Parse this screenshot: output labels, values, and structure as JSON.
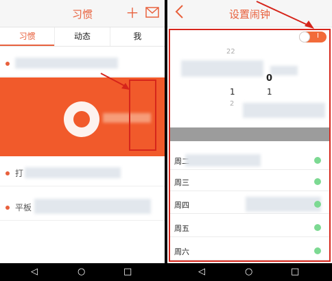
{
  "left_screen": {
    "header": {
      "title": "习惯",
      "add_icon": "plus-icon",
      "mail_icon": "envelope-icon"
    },
    "tabs": [
      {
        "label": "习惯",
        "active": true
      },
      {
        "label": "动态",
        "active": false
      },
      {
        "label": "我",
        "active": false
      }
    ],
    "habits": [
      {
        "label": "",
        "blurred": true
      },
      {
        "label": "",
        "blurred": true
      },
      {
        "label": "打",
        "blurred": true
      },
      {
        "label": "平板",
        "blurred": true
      }
    ]
  },
  "right_screen": {
    "header": {
      "title": "设置闹钟",
      "back_icon": "chevron-left-icon"
    },
    "toggle": {
      "on_mark": "I",
      "state": "on"
    },
    "time_picker": {
      "top_value": "22",
      "selected_minute": "0",
      "hour_value": "1",
      "minute_value": "1",
      "bottom_value": "2"
    },
    "days": [
      {
        "label": "周二"
      },
      {
        "label": "周三"
      },
      {
        "label": "周四"
      },
      {
        "label": "周五"
      },
      {
        "label": "周六"
      }
    ]
  },
  "navigation": {
    "back": "◁",
    "home": "○",
    "recents": "□"
  },
  "colors": {
    "accent": "#e8603c",
    "highlight": "#d6251b",
    "overlay": "#f15a2b",
    "toggle_on": "#f26b3a",
    "day_dot": "#7cd992"
  }
}
